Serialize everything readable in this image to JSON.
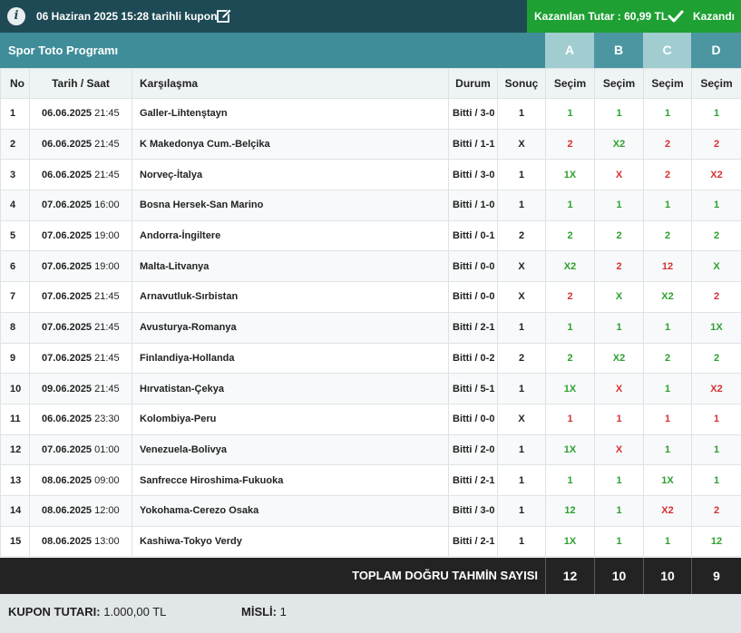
{
  "header": {
    "coupon_title": "06 Haziran 2025 15:28 tarihli kupon",
    "won_amount": "Kazanılan Tutar : 60,99 TL",
    "status": "Kazandı",
    "status_color": "#1ea033",
    "bar_color": "#1e4a55"
  },
  "program": {
    "title": "Spor Toto Programı",
    "columns": [
      "A",
      "B",
      "C",
      "D"
    ]
  },
  "table": {
    "headers": {
      "no": "No",
      "datetime": "Tarih / Saat",
      "match": "Karşılaşma",
      "status": "Durum",
      "result": "Sonuç",
      "pick": "Seçim"
    },
    "rows": [
      {
        "no": "1",
        "date": "06.06.2025",
        "time": "21:45",
        "match": "Galler-Lihtenştayn",
        "status": "Bitti / 3-0",
        "result": "1",
        "picks": [
          {
            "v": "1",
            "ok": true
          },
          {
            "v": "1",
            "ok": true
          },
          {
            "v": "1",
            "ok": true
          },
          {
            "v": "1",
            "ok": true
          }
        ]
      },
      {
        "no": "2",
        "date": "06.06.2025",
        "time": "21:45",
        "match": "K Makedonya Cum.-Belçika",
        "status": "Bitti / 1-1",
        "result": "X",
        "picks": [
          {
            "v": "2",
            "ok": false
          },
          {
            "v": "X2",
            "ok": true
          },
          {
            "v": "2",
            "ok": false
          },
          {
            "v": "2",
            "ok": false
          }
        ]
      },
      {
        "no": "3",
        "date": "06.06.2025",
        "time": "21:45",
        "match": "Norveç-İtalya",
        "status": "Bitti / 3-0",
        "result": "1",
        "picks": [
          {
            "v": "1X",
            "ok": true
          },
          {
            "v": "X",
            "ok": false
          },
          {
            "v": "2",
            "ok": false
          },
          {
            "v": "X2",
            "ok": false
          }
        ]
      },
      {
        "no": "4",
        "date": "07.06.2025",
        "time": "16:00",
        "match": "Bosna Hersek-San Marino",
        "status": "Bitti / 1-0",
        "result": "1",
        "picks": [
          {
            "v": "1",
            "ok": true
          },
          {
            "v": "1",
            "ok": true
          },
          {
            "v": "1",
            "ok": true
          },
          {
            "v": "1",
            "ok": true
          }
        ]
      },
      {
        "no": "5",
        "date": "07.06.2025",
        "time": "19:00",
        "match": "Andorra-İngiltere",
        "status": "Bitti / 0-1",
        "result": "2",
        "picks": [
          {
            "v": "2",
            "ok": true
          },
          {
            "v": "2",
            "ok": true
          },
          {
            "v": "2",
            "ok": true
          },
          {
            "v": "2",
            "ok": true
          }
        ]
      },
      {
        "no": "6",
        "date": "07.06.2025",
        "time": "19:00",
        "match": "Malta-Litvanya",
        "status": "Bitti / 0-0",
        "result": "X",
        "picks": [
          {
            "v": "X2",
            "ok": true
          },
          {
            "v": "2",
            "ok": false
          },
          {
            "v": "12",
            "ok": false
          },
          {
            "v": "X",
            "ok": true
          }
        ]
      },
      {
        "no": "7",
        "date": "07.06.2025",
        "time": "21:45",
        "match": "Arnavutluk-Sırbistan",
        "status": "Bitti / 0-0",
        "result": "X",
        "picks": [
          {
            "v": "2",
            "ok": false
          },
          {
            "v": "X",
            "ok": true
          },
          {
            "v": "X2",
            "ok": true
          },
          {
            "v": "2",
            "ok": false
          }
        ]
      },
      {
        "no": "8",
        "date": "07.06.2025",
        "time": "21:45",
        "match": "Avusturya-Romanya",
        "status": "Bitti / 2-1",
        "result": "1",
        "picks": [
          {
            "v": "1",
            "ok": true
          },
          {
            "v": "1",
            "ok": true
          },
          {
            "v": "1",
            "ok": true
          },
          {
            "v": "1X",
            "ok": true
          }
        ]
      },
      {
        "no": "9",
        "date": "07.06.2025",
        "time": "21:45",
        "match": "Finlandiya-Hollanda",
        "status": "Bitti / 0-2",
        "result": "2",
        "picks": [
          {
            "v": "2",
            "ok": true
          },
          {
            "v": "X2",
            "ok": true
          },
          {
            "v": "2",
            "ok": true
          },
          {
            "v": "2",
            "ok": true
          }
        ]
      },
      {
        "no": "10",
        "date": "09.06.2025",
        "time": "21:45",
        "match": "Hırvatistan-Çekya",
        "status": "Bitti / 5-1",
        "result": "1",
        "picks": [
          {
            "v": "1X",
            "ok": true
          },
          {
            "v": "X",
            "ok": false
          },
          {
            "v": "1",
            "ok": true
          },
          {
            "v": "X2",
            "ok": false
          }
        ]
      },
      {
        "no": "11",
        "date": "06.06.2025",
        "time": "23:30",
        "match": "Kolombiya-Peru",
        "status": "Bitti / 0-0",
        "result": "X",
        "picks": [
          {
            "v": "1",
            "ok": false
          },
          {
            "v": "1",
            "ok": false
          },
          {
            "v": "1",
            "ok": false
          },
          {
            "v": "1",
            "ok": false
          }
        ]
      },
      {
        "no": "12",
        "date": "07.06.2025",
        "time": "01:00",
        "match": "Venezuela-Bolivya",
        "status": "Bitti / 2-0",
        "result": "1",
        "picks": [
          {
            "v": "1X",
            "ok": true
          },
          {
            "v": "X",
            "ok": false
          },
          {
            "v": "1",
            "ok": true
          },
          {
            "v": "1",
            "ok": true
          }
        ]
      },
      {
        "no": "13",
        "date": "08.06.2025",
        "time": "09:00",
        "match": "Sanfrecce Hiroshima-Fukuoka",
        "status": "Bitti / 2-1",
        "result": "1",
        "picks": [
          {
            "v": "1",
            "ok": true
          },
          {
            "v": "1",
            "ok": true
          },
          {
            "v": "1X",
            "ok": true
          },
          {
            "v": "1",
            "ok": true
          }
        ]
      },
      {
        "no": "14",
        "date": "08.06.2025",
        "time": "12:00",
        "match": "Yokohama-Cerezo Osaka",
        "status": "Bitti / 3-0",
        "result": "1",
        "picks": [
          {
            "v": "12",
            "ok": true
          },
          {
            "v": "1",
            "ok": true
          },
          {
            "v": "X2",
            "ok": false
          },
          {
            "v": "2",
            "ok": false
          }
        ]
      },
      {
        "no": "15",
        "date": "08.06.2025",
        "time": "13:00",
        "match": "Kashiwa-Tokyo Verdy",
        "status": "Bitti / 2-1",
        "result": "1",
        "picks": [
          {
            "v": "1X",
            "ok": true
          },
          {
            "v": "1",
            "ok": true
          },
          {
            "v": "1",
            "ok": true
          },
          {
            "v": "12",
            "ok": true
          }
        ]
      }
    ],
    "colors": {
      "correct": "#2ea02e",
      "wrong": "#d63131"
    }
  },
  "totals": {
    "label": "TOPLAM DOĞRU TAHMİN SAYISI",
    "values": [
      "12",
      "10",
      "10",
      "9"
    ]
  },
  "footer": {
    "amount_label": "KUPON TUTARI:",
    "amount_value": "1.000,00 TL",
    "misli_label": "MİSLİ:",
    "misli_value": "1"
  }
}
